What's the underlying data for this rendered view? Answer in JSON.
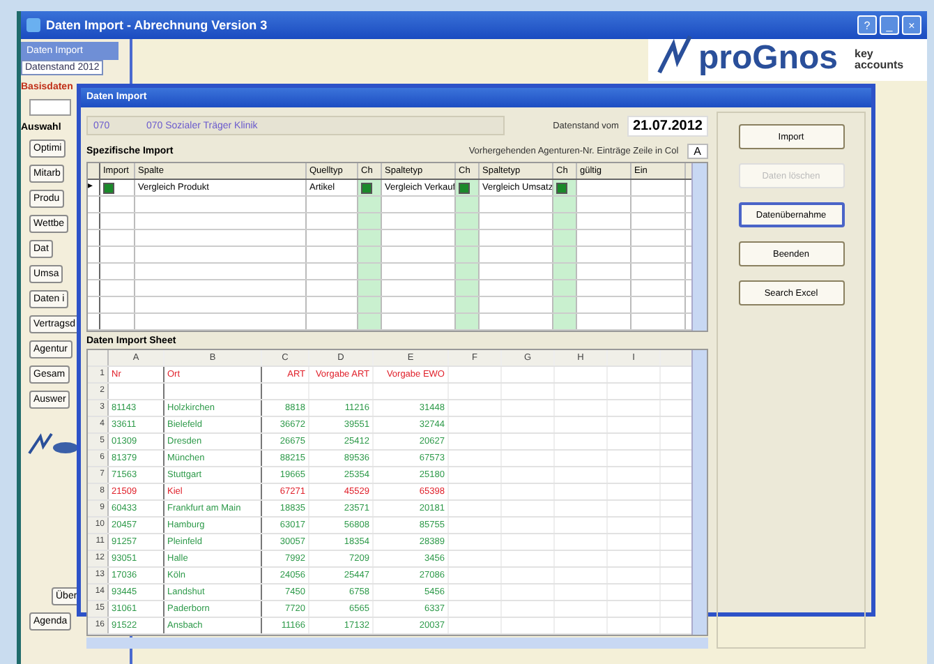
{
  "window": {
    "title": "Daten Import - Abrechnung Version 3",
    "controls": [
      "?",
      "_",
      "×"
    ]
  },
  "sidebar": {
    "header": "Daten Import",
    "field_value": "Datenstand 2012",
    "section_label": "Basisdaten",
    "label": "Auswahl",
    "items": [
      "Optimi",
      "Mitarb",
      "Produ",
      "Wettbe",
      "Dat",
      "Umsa",
      "Daten i",
      "Vertragsd",
      "Agentur",
      "Gesam",
      "Auswer"
    ],
    "footer_items": [
      "Über",
      "Agenda"
    ]
  },
  "logo": {
    "text": "proGnos",
    "tagline": "key accounts"
  },
  "dialog": {
    "title": "Daten Import",
    "code": "070",
    "name": "070 Sozialer Träger Klinik",
    "date_label": "Datenstand vom",
    "date": "21.07.2012",
    "section_label": "Spezifische Import",
    "hint_label": "Vorhergehenden Agenturen-Nr. Einträge Zeile in Col",
    "hint_value": "A",
    "import_grid": {
      "columns": [
        "Import",
        "Spalte",
        "Quelltyp",
        "Ch",
        "Spaltetyp",
        "Ch",
        "Spaltetyp",
        "Ch",
        "gültig",
        "Ein"
      ],
      "rows": [
        {
          "marker": "▸",
          "import": true,
          "spalte": "Vergleich Produkt",
          "quelltyp": "Artikel",
          "checks": [
            true,
            true,
            true
          ],
          "types": [
            "Vergleich Verkauf",
            "Vergleich Umsatz"
          ]
        }
      ]
    },
    "sheet_label": "Daten Import Sheet",
    "sheet": {
      "columns": [
        "A",
        "B",
        "C",
        "D",
        "E",
        "F",
        "G",
        "H",
        "I"
      ],
      "rows": [
        {
          "number": "1",
          "color": "#e0202a",
          "cells": [
            "Nr",
            "Ort",
            "ART",
            "Vorgabe ART",
            "Vorgabe EWO"
          ]
        },
        {
          "number": "2"
        },
        {
          "number": "3",
          "color": "#2e9a4a",
          "cells": [
            "81143",
            "Holzkirchen",
            "8818",
            "11216",
            "31448"
          ]
        },
        {
          "number": "4",
          "color": "#2e9a4a",
          "cells": [
            "33611",
            "Bielefeld",
            "36672",
            "39551",
            "32744"
          ]
        },
        {
          "number": "5",
          "color": "#2e9a4a",
          "cells": [
            "01309",
            "Dresden",
            "26675",
            "25412",
            "20627"
          ]
        },
        {
          "number": "6",
          "color": "#2e9a4a",
          "cells": [
            "81379",
            "München",
            "88215",
            "89536",
            "67573"
          ]
        },
        {
          "number": "7",
          "color": "#2e9a4a",
          "cells": [
            "71563",
            "Stuttgart",
            "19665",
            "25354",
            "25180"
          ]
        },
        {
          "number": "8",
          "color": "#e0202a",
          "cells": [
            "21509",
            "Kiel",
            "67271",
            "45529",
            "65398"
          ]
        },
        {
          "number": "9",
          "color": "#2e9a4a",
          "cells": [
            "60433",
            "Frankfurt am Main",
            "18835",
            "23571",
            "20181"
          ]
        },
        {
          "number": "10",
          "color": "#2e9a4a",
          "cells": [
            "20457",
            "Hamburg",
            "63017",
            "56808",
            "85755"
          ]
        },
        {
          "number": "11",
          "color": "#2e9a4a",
          "cells": [
            "91257",
            "Pleinfeld",
            "30057",
            "18354",
            "28389"
          ]
        },
        {
          "number": "12",
          "color": "#2e9a4a",
          "cells": [
            "93051",
            "Halle",
            "7992",
            "7209",
            "3456"
          ]
        },
        {
          "number": "13",
          "color": "#2e9a4a",
          "cells": [
            "17036",
            "Köln",
            "24056",
            "25447",
            "27086"
          ]
        },
        {
          "number": "14",
          "color": "#2e9a4a",
          "cells": [
            "93445",
            "Landshut",
            "7450",
            "6758",
            "5456"
          ]
        },
        {
          "number": "15",
          "color": "#2e9a4a",
          "cells": [
            "31061",
            "Paderborn",
            "7720",
            "6565",
            "6337"
          ]
        },
        {
          "number": "16",
          "color": "#2e9a4a",
          "cells": [
            "91522",
            "Ansbach",
            "11166",
            "17132",
            "20037"
          ]
        }
      ]
    },
    "buttons": [
      {
        "label": "Import",
        "disabled": false,
        "selected": false
      },
      {
        "label": "Daten löschen",
        "disabled": true,
        "selected": false
      },
      {
        "label": "Datenübernahme",
        "disabled": false,
        "selected": true
      },
      {
        "label": "Beenden",
        "disabled": false,
        "selected": false
      },
      {
        "label": "Search Excel",
        "disabled": false,
        "selected": false
      }
    ]
  }
}
